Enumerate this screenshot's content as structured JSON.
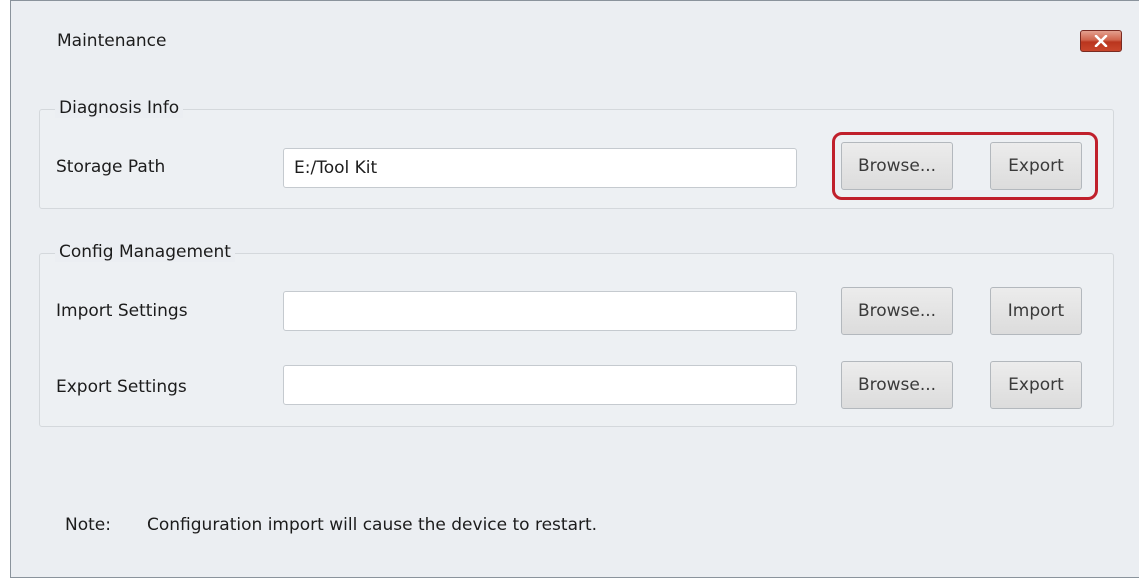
{
  "window": {
    "title": "Maintenance",
    "close_icon": "close-icon",
    "close_color": "#c9462c"
  },
  "diagnosis": {
    "legend": "Diagnosis Info",
    "storage_label": "Storage Path",
    "storage_value": "E:/Tool Kit",
    "browse_label": "Browse...",
    "export_label": "Export",
    "highlight_color": "#c0202c"
  },
  "config": {
    "legend": "Config Management",
    "import_label": "Import Settings",
    "import_value": "",
    "import_browse_label": "Browse...",
    "import_button_label": "Import",
    "export_label": "Export Settings",
    "export_value": "",
    "export_browse_label": "Browse...",
    "export_button_label": "Export"
  },
  "note": {
    "prefix": "Note:",
    "text": "Configuration import will cause the device to restart."
  }
}
